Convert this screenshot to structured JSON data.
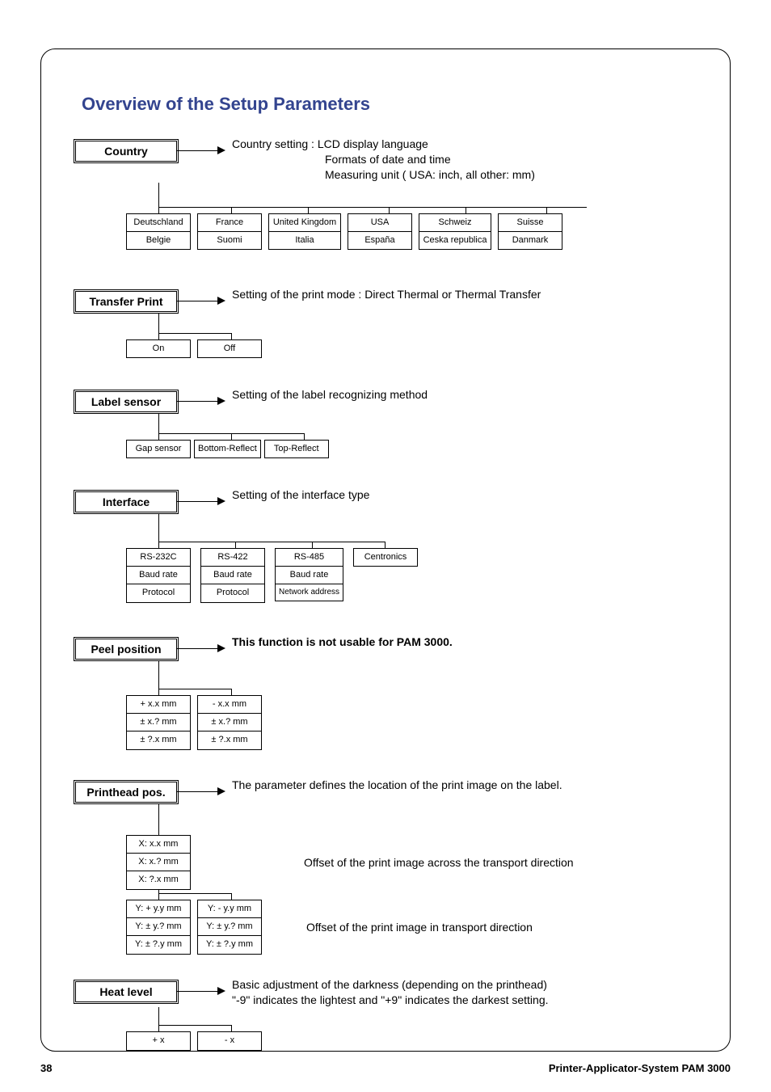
{
  "title": "Overview of the Setup Parameters",
  "country": {
    "label": "Country",
    "desc1": "Country setting :  LCD display language",
    "desc2": "Formats of date and time",
    "desc3": "Measuring unit ( USA: inch, all other: mm)",
    "row1": [
      "Deutschland",
      "France",
      "United Kingdom",
      "USA",
      "Schweiz",
      "Suisse"
    ],
    "row2": [
      "Belgie",
      "Suomi",
      "Italia",
      "España",
      "Ceska republica",
      "Danmark"
    ]
  },
  "transfer": {
    "label": "Transfer Print",
    "desc": "Setting of the print mode : Direct  Thermal or Thermal Transfer",
    "opts": [
      "On",
      "Off"
    ]
  },
  "labelsensor": {
    "label": "Label sensor",
    "desc": "Setting of the label recognizing method",
    "opts": [
      "Gap sensor",
      "Bottom-Reflect",
      "Top-Reflect"
    ]
  },
  "interface": {
    "label": "Interface",
    "desc": "Setting of the interface type",
    "cols": [
      {
        "name": "RS-232C",
        "l2": "Baud rate",
        "l3": "Protocol"
      },
      {
        "name": "RS-422",
        "l2": "Baud rate",
        "l3": "Protocol"
      },
      {
        "name": "RS-485",
        "l2": "Baud rate",
        "l3": "Network address"
      },
      {
        "name": "Centronics"
      }
    ]
  },
  "peel": {
    "label": "Peel position",
    "desc": "This function is not usable for PAM 3000.",
    "c1": [
      "+ x.x mm",
      "± x.? mm",
      "± ?.x mm"
    ],
    "c2": [
      "- x.x mm",
      "± x.? mm",
      "± ?.x mm"
    ]
  },
  "printhead": {
    "label": "Printhead pos.",
    "desc": "The parameter defines the location of the print image on the label.",
    "x": [
      "X: x.x mm",
      "X: x.? mm",
      "X: ?.x mm"
    ],
    "xnote": "Offset of the print image across the transport direction",
    "y1": [
      "Y: + y.y mm",
      "Y: ± y.? mm",
      "Y: ± ?.y mm"
    ],
    "y2": [
      "Y: - y.y mm",
      "Y: ± y.? mm",
      "Y: ± ?.y mm"
    ],
    "ynote": "Offset of the print image in transport direction"
  },
  "heat": {
    "label": "Heat level",
    "desc1": "Basic adjustment of the darkness (depending on the printhead)",
    "desc2": "\"-9\" indicates the lightest and \"+9\" indicates the darkest setting.",
    "opts": [
      "+ x",
      "- x"
    ]
  },
  "footer": {
    "page": "38",
    "doc": "Printer-Applicator-System PAM 3000"
  }
}
